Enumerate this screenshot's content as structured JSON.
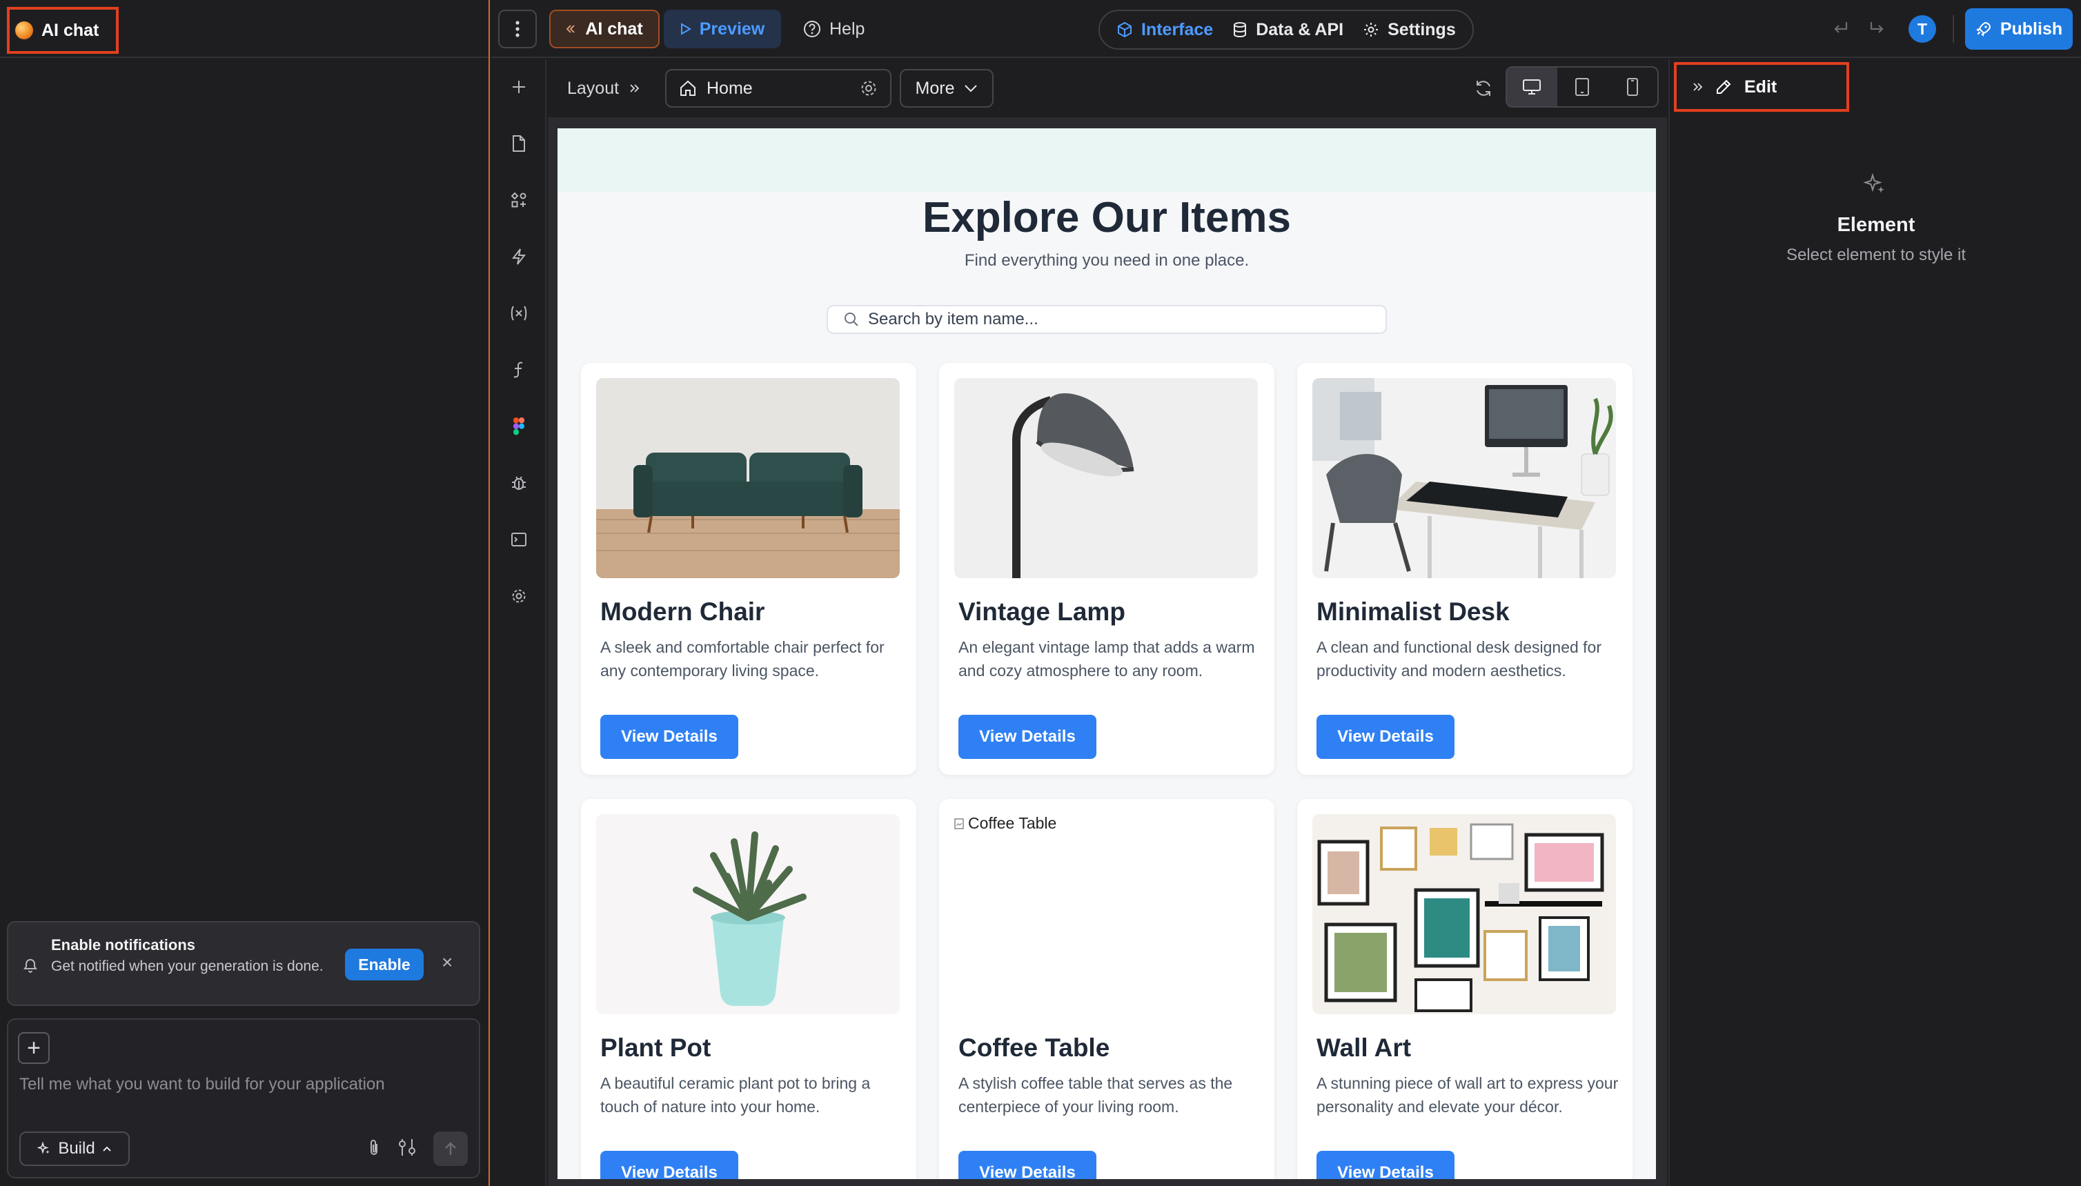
{
  "left_panel": {
    "tab_label": "AI chat",
    "notification": {
      "title": "Enable notifications",
      "body": "Get notified when your generation is done.",
      "enable_label": "Enable",
      "close_glyph": "×"
    },
    "chat": {
      "add_glyph": "+",
      "placeholder": "Tell me what you want to build for your application",
      "mode_label": "Build"
    }
  },
  "topbar": {
    "ai_chat_label": "AI chat",
    "preview_label": "Preview",
    "help_label": "Help",
    "center_tabs": [
      {
        "label": "Interface",
        "icon": "cube-icon",
        "active": true
      },
      {
        "label": "Data & API",
        "icon": "database-icon",
        "active": false
      },
      {
        "label": "Settings",
        "icon": "gear-icon",
        "active": false
      }
    ],
    "avatar_initial": "T",
    "publish_label": "Publish"
  },
  "toolbar": {
    "layout_label": "Layout",
    "page_label": "Home",
    "more_label": "More"
  },
  "canvas": {
    "heading": "Explore Our Items",
    "subheading": "Find everything you need in one place.",
    "search_placeholder": "Search by item name...",
    "button_label": "View Details",
    "items": [
      {
        "title": "Modern Chair",
        "description": "A sleek and comfortable chair perfect for any contemporary living space."
      },
      {
        "title": "Vintage Lamp",
        "description": "An elegant vintage lamp that adds a warm and cozy atmosphere to any room."
      },
      {
        "title": "Minimalist Desk",
        "description": "A clean and functional desk designed for productivity and modern aesthetics."
      },
      {
        "title": "Plant Pot",
        "description": "A beautiful ceramic plant pot to bring a touch of nature into your home."
      },
      {
        "title": "Coffee Table",
        "description": "A stylish coffee table that serves as the centerpiece of your living room.",
        "broken_image_alt": "Coffee Table"
      },
      {
        "title": "Wall Art",
        "description": "A stunning piece of wall art to express your personality and elevate your décor."
      }
    ]
  },
  "right_panel": {
    "tab_label": "Edit",
    "element_title": "Element",
    "element_hint": "Select element to style it"
  },
  "colors": {
    "accent": "#1f7ae0",
    "highlight_border": "#e2401f",
    "button_blue": "#2f80f4"
  }
}
